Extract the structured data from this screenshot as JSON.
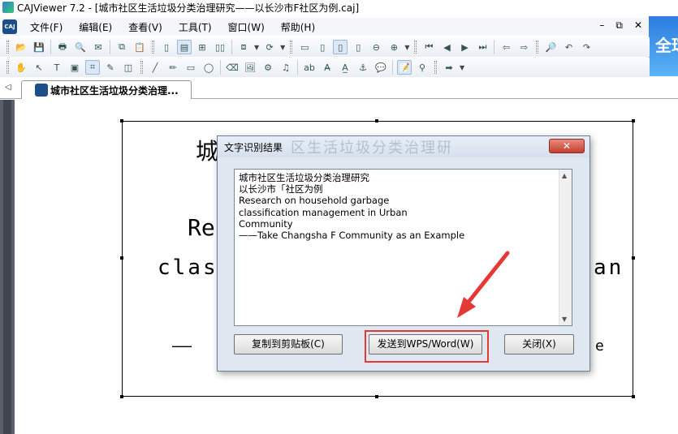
{
  "window": {
    "title": "CAJViewer 7.2 - [城市社区生活垃圾分类治理研究——以长沙市F社区为例.caj]"
  },
  "menu": {
    "items": [
      "文件(F)",
      "编辑(E)",
      "查看(V)",
      "工具(T)",
      "窗口(W)",
      "帮助(H)"
    ],
    "doc_icon_text": "CAJ",
    "win_controls": [
      "–",
      "⧉",
      "✕"
    ],
    "banner_text": "全球"
  },
  "tabs": {
    "active_label": "城市社区生活垃圾分类治理..."
  },
  "page": {
    "line_cn": "城",
    "line_re": "Re",
    "line_class": "class",
    "line_an": "an",
    "line_dash": "——",
    "line_e": "e"
  },
  "dialog": {
    "title": "文字识别结果",
    "title_ghost": "区生活垃圾分类治理研",
    "close_symbol": "✕",
    "recognized_lines": [
      "城市社区生活垃圾分类治理研究",
      "以长沙市「社区为例",
      "Research on household garbage",
      "classification management in Urban",
      "Community",
      "——Take Changsha F Community as an Example"
    ],
    "buttons": {
      "copy": "复制到剪贴板(C)",
      "send": "发送到WPS/Word(W)",
      "close": "关闭(X)"
    }
  },
  "colors": {
    "highlight": "#e53935",
    "arrow": "#e53935",
    "dialog_close": "#c4402f"
  }
}
